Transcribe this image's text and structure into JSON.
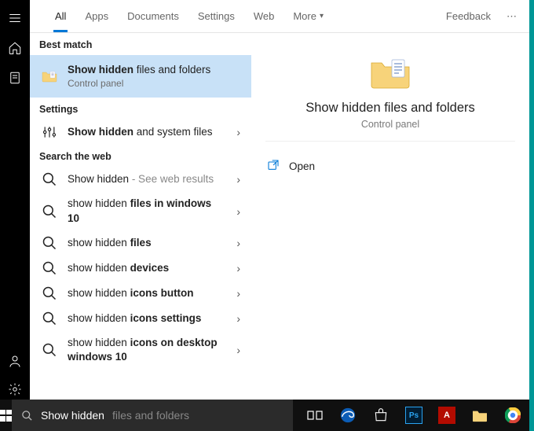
{
  "tabs": [
    {
      "label": "All",
      "active": true
    },
    {
      "label": "Apps",
      "active": false
    },
    {
      "label": "Documents",
      "active": false
    },
    {
      "label": "Settings",
      "active": false
    },
    {
      "label": "Web",
      "active": false
    }
  ],
  "more_tab": "More",
  "feedback_label": "Feedback",
  "sections": {
    "best_match": "Best match",
    "settings": "Settings",
    "search_web": "Search the web"
  },
  "best_match_item": {
    "title_bold": "Show hidden",
    "title_rest": " files and folders",
    "subtitle": "Control panel"
  },
  "settings_items": [
    {
      "title_bold": "Show hidden",
      "title_rest": " and system files"
    }
  ],
  "web_items": [
    {
      "prefix": "Show hidden",
      "bold": "",
      "suffix_dim": " - See web results"
    },
    {
      "prefix": "show hidden ",
      "bold": "files in windows 10",
      "suffix_dim": ""
    },
    {
      "prefix": "show hidden ",
      "bold": "files",
      "suffix_dim": ""
    },
    {
      "prefix": "show hidden ",
      "bold": "devices",
      "suffix_dim": ""
    },
    {
      "prefix": "show hidden ",
      "bold": "icons button",
      "suffix_dim": ""
    },
    {
      "prefix": "show hidden ",
      "bold": "icons settings",
      "suffix_dim": ""
    },
    {
      "prefix": "show hidden ",
      "bold": "icons on desktop windows 10",
      "suffix_dim": ""
    }
  ],
  "preview": {
    "title": "Show hidden files and folders",
    "subtitle": "Control panel",
    "actions": [
      {
        "label": "Open"
      }
    ]
  },
  "search": {
    "typed": "Show hidden",
    "completion": " files and folders"
  },
  "taskbar_items": [
    {
      "name": "task-view-icon"
    },
    {
      "name": "edge-icon"
    },
    {
      "name": "store-icon"
    },
    {
      "name": "photoshop-icon"
    },
    {
      "name": "acrobat-icon"
    },
    {
      "name": "file-explorer-icon"
    },
    {
      "name": "chrome-icon"
    },
    {
      "name": "chrome-icon-2"
    }
  ],
  "rail_top": [
    {
      "name": "hamburger-icon"
    },
    {
      "name": "home-icon"
    },
    {
      "name": "document-icon"
    }
  ],
  "rail_bottom": [
    {
      "name": "user-icon"
    },
    {
      "name": "gear-icon"
    },
    {
      "name": "picture-icon"
    }
  ]
}
